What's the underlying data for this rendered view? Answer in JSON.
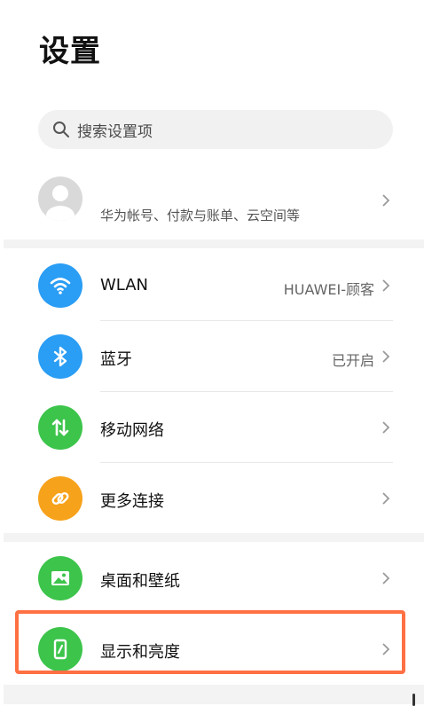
{
  "page": {
    "title": "设置"
  },
  "search": {
    "placeholder": "搜索设置项"
  },
  "account": {
    "subtitle": "华为帐号、付款与账单、云空间等"
  },
  "items": [
    {
      "label": "WLAN",
      "value": "HUAWEI-顾客",
      "icon": "wifi-icon",
      "color": "#2a9df4"
    },
    {
      "label": "蓝牙",
      "value": "已开启",
      "icon": "bluetooth-icon",
      "color": "#2a9df4"
    },
    {
      "label": "移动网络",
      "value": "",
      "icon": "mobile-data-icon",
      "color": "#3cc44b"
    },
    {
      "label": "更多连接",
      "value": "",
      "icon": "link-icon",
      "color": "#f7a21b"
    },
    {
      "label": "桌面和壁纸",
      "value": "",
      "icon": "image-icon",
      "color": "#3cc44b"
    },
    {
      "label": "显示和亮度",
      "value": "",
      "icon": "display-brightness-icon",
      "color": "#3cc44b"
    }
  ],
  "colors": {
    "highlight": "#ff7043",
    "blue": "#2a9df4",
    "green": "#3cc44b",
    "orange": "#f7a21b"
  }
}
